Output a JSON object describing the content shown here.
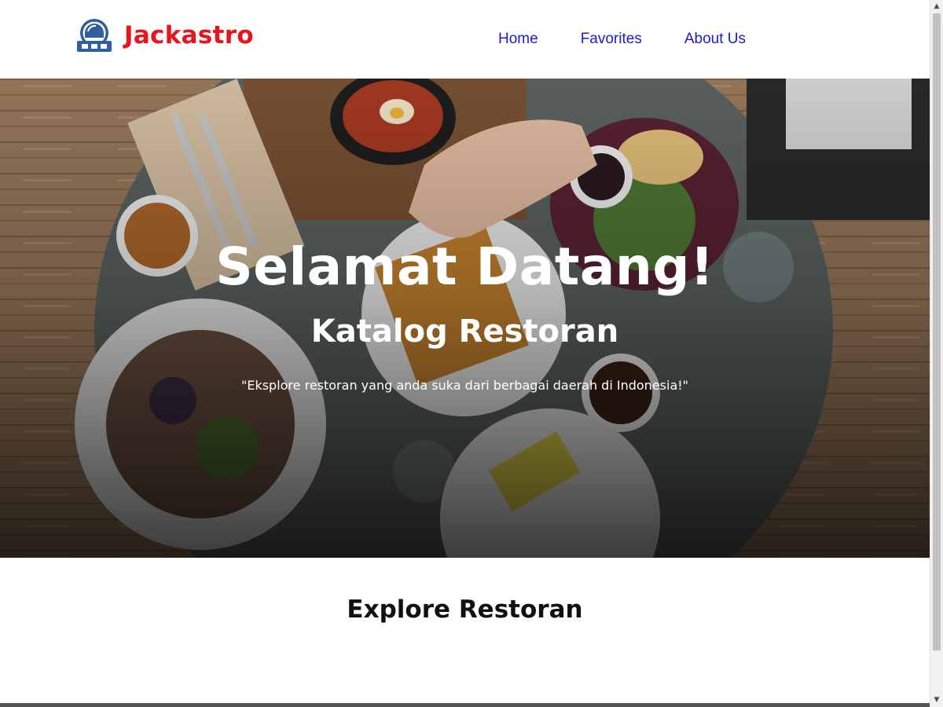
{
  "brand": {
    "name": "Jackastro",
    "logo_icon": "astronaut-helmet-icon",
    "color": "#e8141e"
  },
  "nav": {
    "items": [
      {
        "label": "Home"
      },
      {
        "label": "Favorites"
      },
      {
        "label": "About Us"
      }
    ],
    "link_color": "#1d1ad0"
  },
  "hero": {
    "title": "Selamat Datang!",
    "subtitle": "Katalog Restoran",
    "tagline": "\"Eksplore restoran yang anda suka dari berbagai daerah di Indonesia!\""
  },
  "explore": {
    "title": "Explore Restoran"
  },
  "scrollbar": {
    "up_icon": "scroll-up-arrow-icon",
    "down_icon": "scroll-down-arrow-icon"
  }
}
